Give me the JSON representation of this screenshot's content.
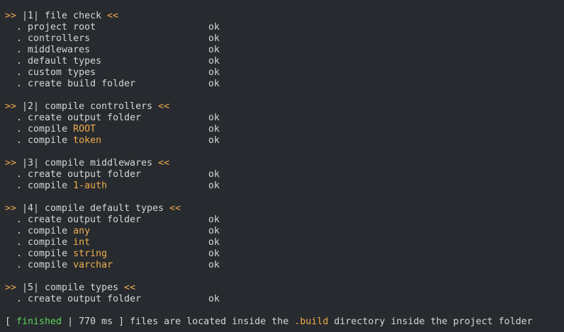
{
  "colors": {
    "background": "#272a2e",
    "text": "#d6d6d6",
    "accent": "#f0ad4e",
    "success": "#5fd75f"
  },
  "steps": [
    {
      "prefix": ">>",
      "title": " |1| file check ",
      "suffix": "<<",
      "items": [
        {
          "dot": "  . ",
          "label": "project root",
          "highlight": "",
          "status": "ok"
        },
        {
          "dot": "  . ",
          "label": "controllers",
          "highlight": "",
          "status": "ok"
        },
        {
          "dot": "  . ",
          "label": "middlewares",
          "highlight": "",
          "status": "ok"
        },
        {
          "dot": "  . ",
          "label": "default types",
          "highlight": "",
          "status": "ok"
        },
        {
          "dot": "  . ",
          "label": "custom types",
          "highlight": "",
          "status": "ok"
        },
        {
          "dot": "  . ",
          "label": "create build folder",
          "highlight": "",
          "status": "ok"
        }
      ]
    },
    {
      "prefix": ">>",
      "title": " |2| compile controllers ",
      "suffix": "<<",
      "items": [
        {
          "dot": "  . ",
          "label": "create output folder",
          "highlight": "",
          "status": "ok"
        },
        {
          "dot": "  . ",
          "label": "compile ",
          "highlight": "ROOT",
          "status": "ok"
        },
        {
          "dot": "  . ",
          "label": "compile ",
          "highlight": "token",
          "status": "ok"
        }
      ]
    },
    {
      "prefix": ">>",
      "title": " |3| compile middlewares ",
      "suffix": "<<",
      "items": [
        {
          "dot": "  . ",
          "label": "create output folder",
          "highlight": "",
          "status": "ok"
        },
        {
          "dot": "  . ",
          "label": "compile ",
          "highlight": "1-auth",
          "status": "ok"
        }
      ]
    },
    {
      "prefix": ">>",
      "title": " |4| compile default types ",
      "suffix": "<<",
      "items": [
        {
          "dot": "  . ",
          "label": "create output folder",
          "highlight": "",
          "status": "ok"
        },
        {
          "dot": "  . ",
          "label": "compile ",
          "highlight": "any",
          "status": "ok"
        },
        {
          "dot": "  . ",
          "label": "compile ",
          "highlight": "int",
          "status": "ok"
        },
        {
          "dot": "  . ",
          "label": "compile ",
          "highlight": "string",
          "status": "ok"
        },
        {
          "dot": "  . ",
          "label": "compile ",
          "highlight": "varchar",
          "status": "ok"
        }
      ]
    },
    {
      "prefix": ">>",
      "title": " |5| compile types ",
      "suffix": "<<",
      "items": [
        {
          "dot": "  . ",
          "label": "create output folder",
          "highlight": "",
          "status": "ok"
        }
      ]
    }
  ],
  "footer": {
    "open_bracket": "[ ",
    "state": "finished",
    "separator": " | ",
    "duration": "770 ms",
    "close_bracket": " ] ",
    "message_before": "files are located inside the ",
    "dir": ".build",
    "message_after": " directory inside the project folder"
  }
}
